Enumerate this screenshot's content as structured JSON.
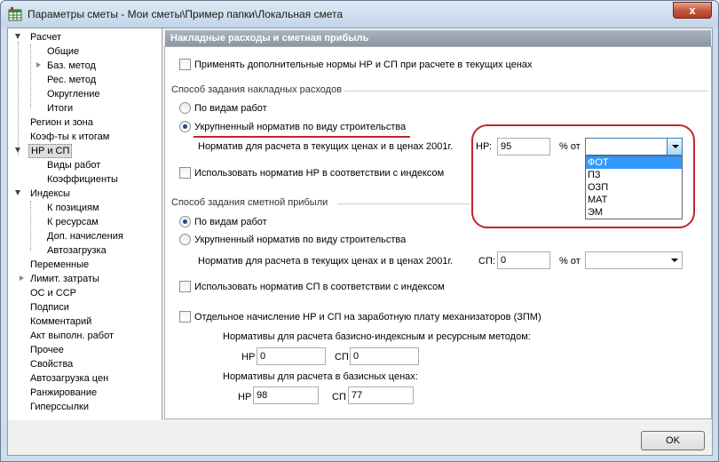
{
  "window": {
    "title": "Параметры сметы - Мои сметы\\Пример папки\\Локальная смета",
    "close_label": "x"
  },
  "tree": {
    "items": [
      {
        "label": "Расчет"
      },
      {
        "label": "Общие"
      },
      {
        "label": "Баз. метод"
      },
      {
        "label": "Рес. метод"
      },
      {
        "label": "Округление"
      },
      {
        "label": "Итоги"
      },
      {
        "label": "Регион и зона"
      },
      {
        "label": "Коэф-ты к итогам"
      },
      {
        "label": "НР и СП"
      },
      {
        "label": "Виды работ"
      },
      {
        "label": "Коэффициенты"
      },
      {
        "label": "Индексы"
      },
      {
        "label": "К позициям"
      },
      {
        "label": "К ресурсам"
      },
      {
        "label": "Доп. начисления"
      },
      {
        "label": "Автозагрузка"
      },
      {
        "label": "Переменные"
      },
      {
        "label": "Лимит. затраты"
      },
      {
        "label": "ОС и ССР"
      },
      {
        "label": "Подписи"
      },
      {
        "label": "Комментарий"
      },
      {
        "label": "Акт выполн. работ"
      },
      {
        "label": "Прочее"
      },
      {
        "label": "Свойства"
      },
      {
        "label": "Автозагрузка цен"
      },
      {
        "label": "Ранжирование"
      },
      {
        "label": "Гиперссылки"
      }
    ]
  },
  "panel": {
    "header": "Накладные расходы и сметная прибыль",
    "additional_norms_checkbox": "Применять дополнительные нормы НР и СП при расчете в текущих ценах",
    "overhead": {
      "group_title": "Способ задания накладных расходов",
      "radio_by_work_types": "По видам работ",
      "radio_aggregated": "Укрупненный норматив по виду строительства",
      "norm_label": "Норматив для расчета в текущих ценах и в ценах 2001г.",
      "nr_label": "НР:",
      "nr_value": "95",
      "percent_label": "% от",
      "base_value": "",
      "options": [
        "ФОТ",
        "ПЗ",
        "ОЗП",
        "МАТ",
        "ЭМ"
      ],
      "selected_option": "ФОТ",
      "index_checkbox": "Использовать норматив НР в соответствии с индексом"
    },
    "profit": {
      "group_title": "Способ задания сметной прибыли",
      "radio_by_work_types": "По видам работ",
      "radio_aggregated": "Укрупненный норматив по виду строительства",
      "norm_label": "Норматив для расчета в текущих ценах и в ценах 2001г.",
      "sp_label": "СП:",
      "sp_value": "0",
      "percent_label": "% от",
      "base_value": "",
      "index_checkbox": "Использовать норматив СП в соответствии с индексом"
    },
    "zpm": {
      "checkbox": "Отдельное начисление НР и СП на заработную плату механизаторов (ЗПМ)",
      "base_index_label": "Нормативы для расчета базисно-индексным и ресурсным методом:",
      "nr_label": "НР",
      "nr_value": "0",
      "sp_label": "СП",
      "sp_value": "0",
      "base_prices_label": "Нормативы для расчета в базисных ценах:",
      "nr2_label": "НР",
      "nr2_value": "98",
      "sp2_label": "СП",
      "sp2_value": "77"
    }
  },
  "footer": {
    "ok_label": "OK"
  },
  "colors": {
    "annotation": "#c0262e",
    "selection": "#3399ff",
    "header_bg": "#8a96a3"
  }
}
